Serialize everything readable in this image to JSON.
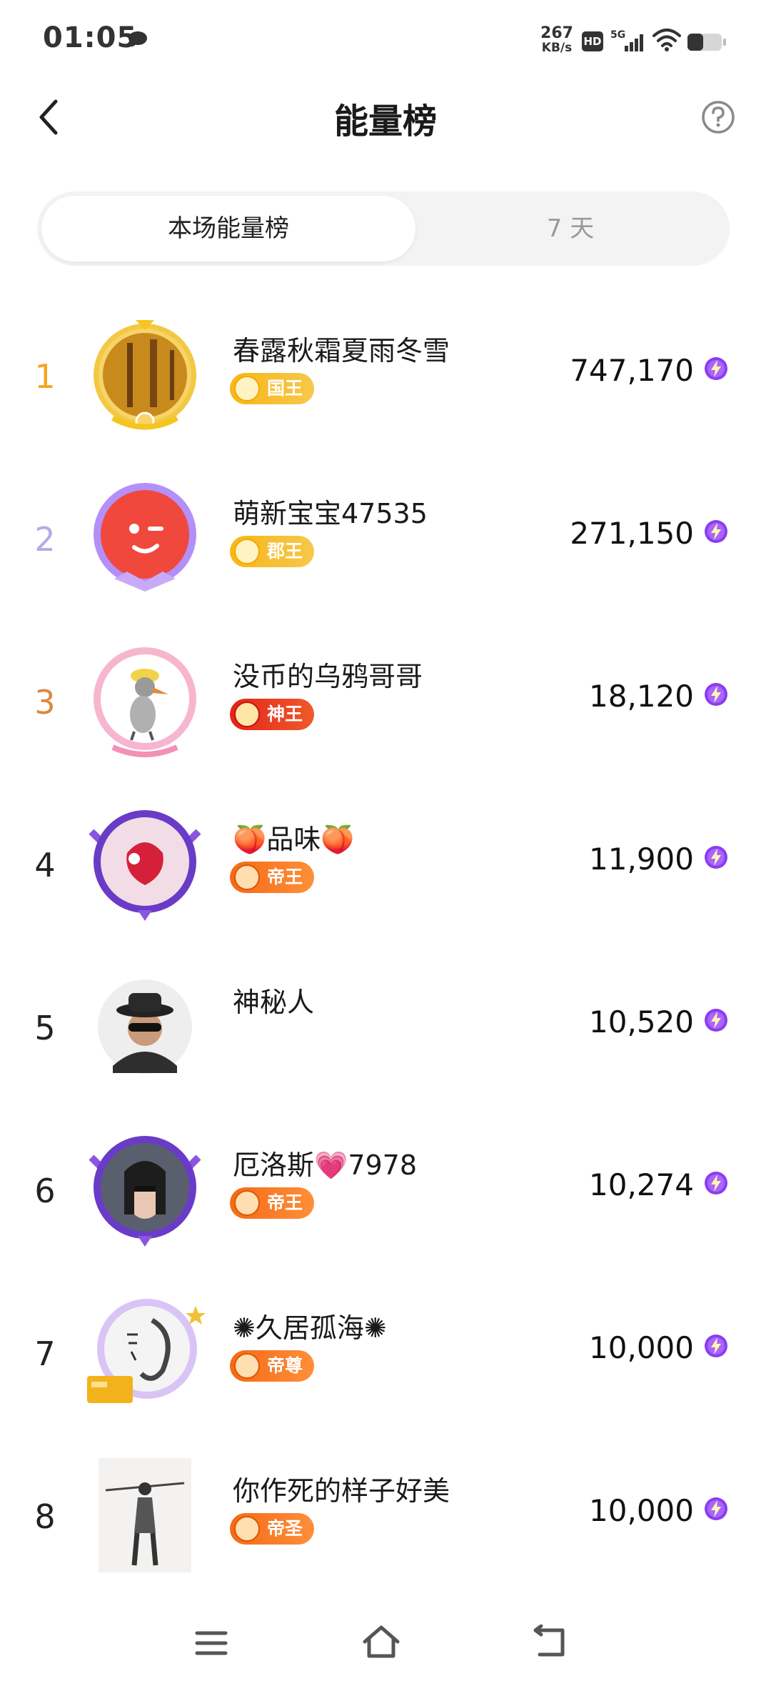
{
  "status_bar": {
    "time": "01:05",
    "net_speed_value": "267",
    "net_speed_unit": "KB/s",
    "hd_label": "HD",
    "network_label": "5G",
    "icons": [
      "chat-bubble-icon",
      "hd-icon",
      "signal-icon",
      "wifi-icon",
      "battery-icon"
    ]
  },
  "header": {
    "title": "能量榜",
    "back_icon": "chevron-left-icon",
    "help_icon": "question-circle-icon"
  },
  "tabs": [
    {
      "label": "本场能量榜",
      "active": true
    },
    {
      "label": "7 天",
      "active": false
    }
  ],
  "colors": {
    "rank1": "#f2a623",
    "rank2": "#b7a9e6",
    "rank3": "#d98a3f",
    "bolt": "#8a3df0"
  },
  "ranking": [
    {
      "rank": "1",
      "name": "春露秋霜夏雨冬雪",
      "badge": "国王",
      "badge_style": "gold",
      "score": "747,170"
    },
    {
      "rank": "2",
      "name": "萌新宝宝47535",
      "badge": "郡王",
      "badge_style": "gold",
      "score": "271,150"
    },
    {
      "rank": "3",
      "name": "没币的乌鸦哥哥",
      "badge": "神王",
      "badge_style": "red",
      "score": "18,120"
    },
    {
      "rank": "4",
      "name": "🍑品味🍑",
      "badge": "帝王",
      "badge_style": "orange",
      "score": "11,900"
    },
    {
      "rank": "5",
      "name": "神秘人",
      "badge": "",
      "badge_style": "",
      "score": "10,520"
    },
    {
      "rank": "6",
      "name": "厄洛斯💗7978",
      "badge": "帝王",
      "badge_style": "orange",
      "score": "10,274"
    },
    {
      "rank": "7",
      "name": "✺久居孤海✺",
      "badge": "帝尊",
      "badge_style": "orange",
      "score": "10,000"
    },
    {
      "rank": "8",
      "name": "你作死的样子好美",
      "badge": "帝圣",
      "badge_style": "orange",
      "score": "10,000"
    }
  ],
  "nav_bar": {
    "icons": [
      "menu-icon",
      "home-icon",
      "back-icon"
    ]
  }
}
